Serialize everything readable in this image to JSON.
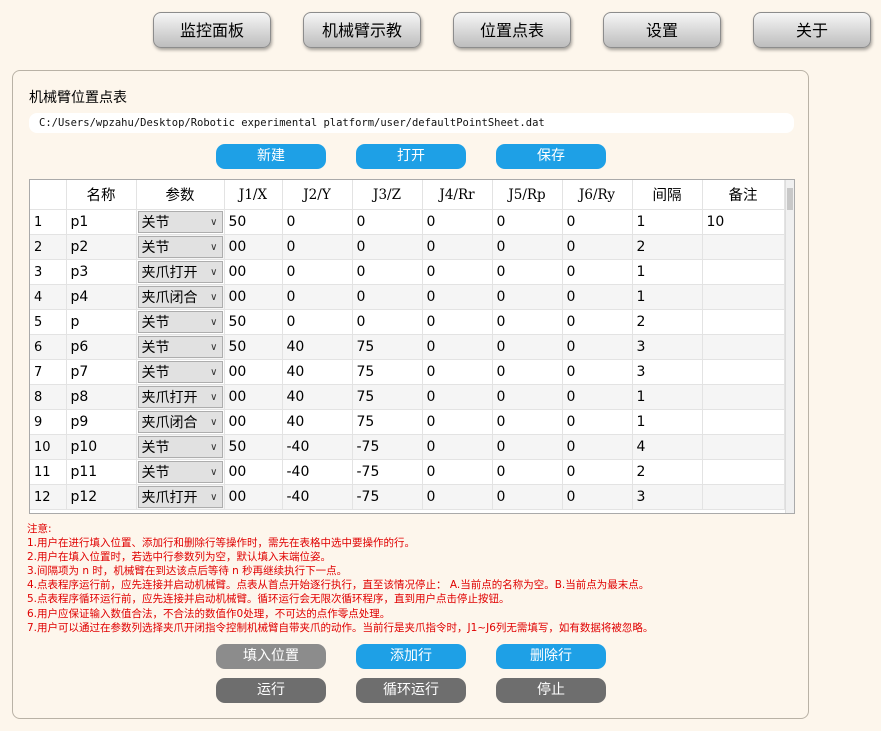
{
  "nav": {
    "items": [
      "监控面板",
      "机械臂示教",
      "位置点表",
      "设置",
      "关于"
    ]
  },
  "panel": {
    "title": "机械臂位置点表",
    "path": "C:/Users/wpzahu/Desktop/Robotic experimental platform/user/defaultPointSheet.dat",
    "file_buttons": {
      "new": "新建",
      "open": "打开",
      "save": "保存"
    }
  },
  "table": {
    "headers": [
      "",
      "名称",
      "参数",
      "J1/X",
      "J2/Y",
      "J3/Z",
      "J4/Rr",
      "J5/Rp",
      "J6/Ry",
      "间隔",
      "备注"
    ],
    "rows": [
      [
        "1",
        "p1",
        "关节",
        "50",
        "0",
        "0",
        "0",
        "0",
        "0",
        "1",
        "10"
      ],
      [
        "2",
        "p2",
        "关节",
        "00",
        "0",
        "0",
        "0",
        "0",
        "0",
        "2",
        ""
      ],
      [
        "3",
        "p3",
        "夹爪打开",
        "00",
        "0",
        "0",
        "0",
        "0",
        "0",
        "1",
        ""
      ],
      [
        "4",
        "p4",
        "夹爪闭合",
        "00",
        "0",
        "0",
        "0",
        "0",
        "0",
        "1",
        ""
      ],
      [
        "5",
        "p",
        "关节",
        "50",
        "0",
        "0",
        "0",
        "0",
        "0",
        "2",
        ""
      ],
      [
        "6",
        "p6",
        "关节",
        "50",
        "40",
        "75",
        "0",
        "0",
        "0",
        "3",
        ""
      ],
      [
        "7",
        "p7",
        "关节",
        "00",
        "40",
        "75",
        "0",
        "0",
        "0",
        "3",
        ""
      ],
      [
        "8",
        "p8",
        "夹爪打开",
        "00",
        "40",
        "75",
        "0",
        "0",
        "0",
        "1",
        ""
      ],
      [
        "9",
        "p9",
        "夹爪闭合",
        "00",
        "40",
        "75",
        "0",
        "0",
        "0",
        "1",
        ""
      ],
      [
        "10",
        "p10",
        "关节",
        "50",
        "-40",
        "-75",
        "0",
        "0",
        "0",
        "4",
        ""
      ],
      [
        "11",
        "p11",
        "关节",
        "00",
        "-40",
        "-75",
        "0",
        "0",
        "0",
        "2",
        ""
      ],
      [
        "12",
        "p12",
        "夹爪打开",
        "00",
        "-40",
        "-75",
        "0",
        "0",
        "0",
        "3",
        ""
      ]
    ]
  },
  "notes": [
    "注意:",
    "1.用户在进行填入位置、添加行和删除行等操作时，需先在表格中选中要操作的行。",
    "2.用户在填入位置时，若选中行参数列为空，默认填入末端位姿。",
    "3.间隔项为 n 时，机械臂在到达该点后等待 n 秒再继续执行下一点。",
    "4.点表程序运行前，应先连接并启动机械臂。点表从首点开始逐行执行，直至该情况停止： A.当前点的名称为空。B.当前点为最末点。",
    "5.点表程序循环运行前，应先连接并启动机械臂。循环运行会无限次循环程序，直到用户点击停止按钮。",
    "6.用户应保证输入数值合法，不合法的数值作0处理，不可达的点作零点处理。",
    "7.用户可以通过在参数列选择夹爪开闭指令控制机械臂自带夹爪的动作。当前行是夹爪指令时，J1~J6列无需填写，如有数据将被忽略。"
  ],
  "actions": {
    "fill_position": "填入位置",
    "add_row": "添加行",
    "delete_row": "删除行",
    "run": "运行",
    "loop_run": "循环运行",
    "stop": "停止"
  },
  "colors": {
    "blue_button": "#1ea0e6",
    "gray_button": "#8c8c8c",
    "note_text": "#e00000",
    "background": "#fdf6ec"
  }
}
